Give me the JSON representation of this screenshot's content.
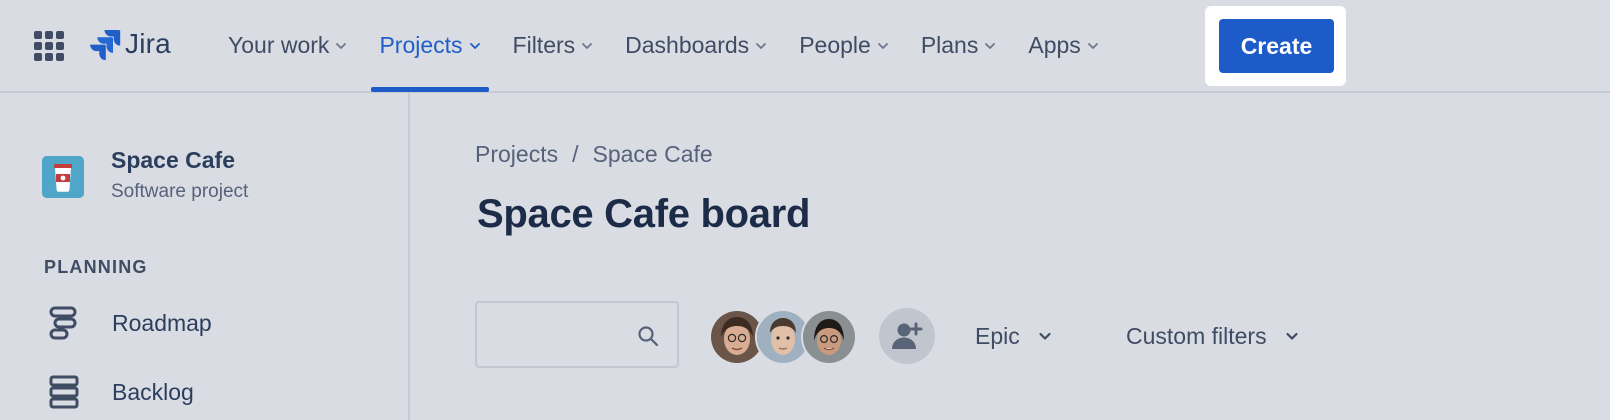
{
  "app": {
    "name": "Jira"
  },
  "nav": {
    "items": [
      {
        "label": "Your work",
        "active": false
      },
      {
        "label": "Projects",
        "active": true
      },
      {
        "label": "Filters",
        "active": false
      },
      {
        "label": "Dashboards",
        "active": false
      },
      {
        "label": "People",
        "active": false
      },
      {
        "label": "Plans",
        "active": false
      },
      {
        "label": "Apps",
        "active": false
      }
    ],
    "create_label": "Create"
  },
  "sidebar": {
    "project_name": "Space Cafe",
    "project_type": "Software project",
    "section_label": "PLANNING",
    "items": [
      {
        "label": "Roadmap",
        "icon": "roadmap-icon"
      },
      {
        "label": "Backlog",
        "icon": "backlog-icon"
      }
    ]
  },
  "main": {
    "breadcrumb": [
      "Projects",
      "Space Cafe"
    ],
    "breadcrumb_separator": "/",
    "title": "Space Cafe board",
    "search": {
      "value": "",
      "placeholder": ""
    },
    "filters": {
      "epic_label": "Epic",
      "custom_label": "Custom filters"
    }
  },
  "colors": {
    "background": "#d9dce3",
    "accent": "#1c5bc8",
    "text": "#2c3e5d",
    "project_avatar": "#4fa6c8"
  }
}
